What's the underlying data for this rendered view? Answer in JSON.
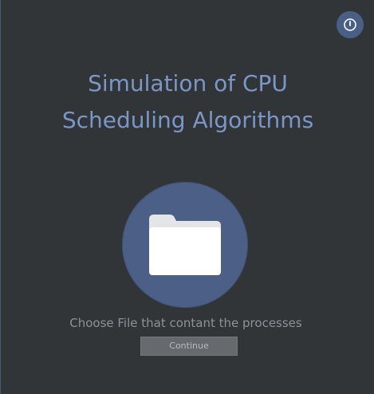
{
  "header": {
    "power_icon": "power-icon"
  },
  "main": {
    "title_line1": "Simulation of CPU",
    "title_line2": "Scheduling Algorithms",
    "folder_icon": "folder-icon",
    "prompt": "Choose File that contant the processes",
    "continue_label": "Continue"
  },
  "colors": {
    "background": "#313538",
    "accent": "#4c5f87",
    "title_text": "#7b97c7"
  }
}
